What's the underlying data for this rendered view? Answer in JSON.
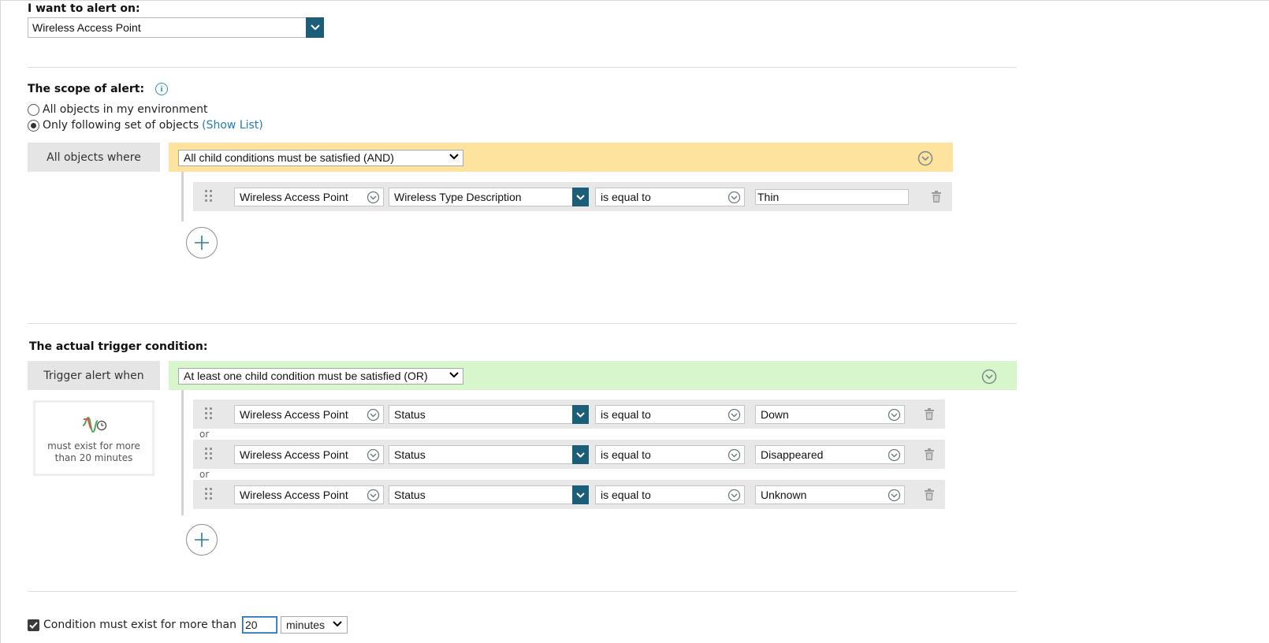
{
  "alert_on": {
    "label": "I want to alert on:",
    "value": "Wireless Access Point"
  },
  "scope": {
    "title": "The scope of alert:",
    "options": [
      {
        "label": "All objects in my environment",
        "selected": false
      },
      {
        "label": "Only following set of objects",
        "selected": true,
        "link": "(Show List)"
      }
    ],
    "where_label": "All objects where",
    "group_mode": "All child conditions must be satisfied (AND)",
    "band_color": "#fde39e",
    "conditions": [
      {
        "object": "Wireless Access Point",
        "field": "Wireless Type Description",
        "operator": "is equal to",
        "value": "Thin"
      }
    ]
  },
  "trigger": {
    "title": "The actual trigger condition:",
    "when_label": "Trigger alert when",
    "group_mode": "At least one child condition must be satisfied (OR)",
    "band_color": "#d7f6cb",
    "side_note": "must exist for more than 20 minutes",
    "joiner": "or",
    "conditions": [
      {
        "object": "Wireless Access Point",
        "field": "Status",
        "operator": "is equal to",
        "value": "Down"
      },
      {
        "object": "Wireless Access Point",
        "field": "Status",
        "operator": "is equal to",
        "value": "Disappeared"
      },
      {
        "object": "Wireless Access Point",
        "field": "Status",
        "operator": "is equal to",
        "value": "Unknown"
      }
    ]
  },
  "duration": {
    "checked": true,
    "label": "Condition must exist for more than",
    "amount": "20",
    "unit": "minutes"
  },
  "colors": {
    "accent_dark": "#1c5d78",
    "link": "#1f7cb5",
    "info": "#2c8fc2"
  }
}
